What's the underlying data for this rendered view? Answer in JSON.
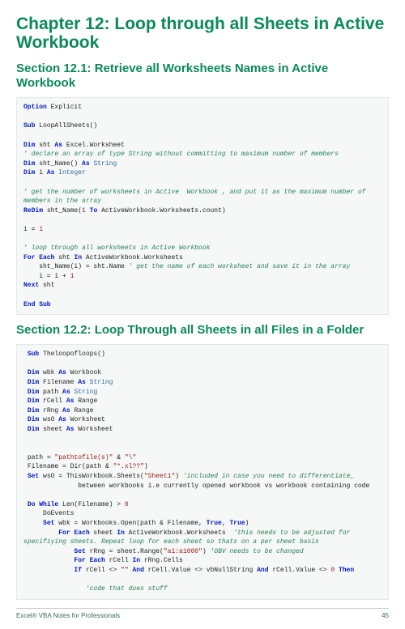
{
  "chapter_title": "Chapter 12: Loop through all Sheets in Active Workbook",
  "section1_title": "Section 12.1: Retrieve all Worksheets Names in Active Workbook",
  "section2_title": "Section 12.2: Loop Through all Sheets in all Files in a Folder",
  "footer_left": "Excel® VBA Notes for Professionals",
  "footer_right": "45"
}
